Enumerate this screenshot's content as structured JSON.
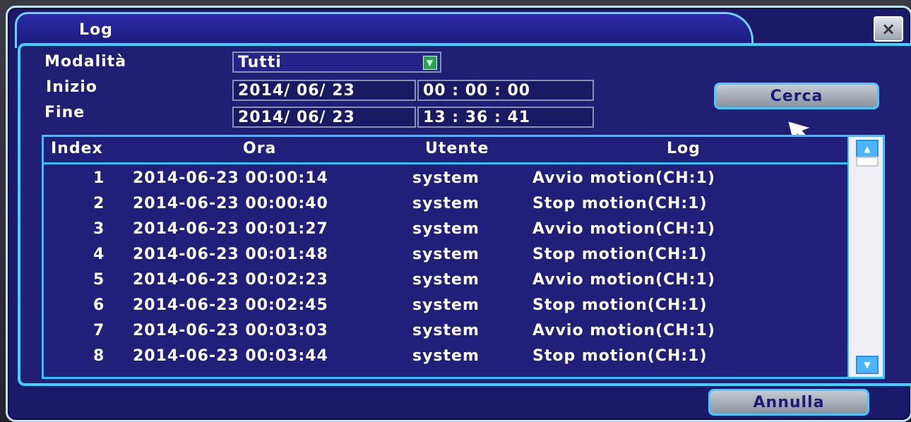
{
  "window": {
    "title": "Log",
    "close_symbol": "×"
  },
  "form": {
    "mode_label": "Modalità",
    "mode_value": "Tutti",
    "start_label": "Inizio",
    "start_date": "2014/ 06/ 23",
    "start_time": "00 : 00 : 00",
    "end_label": "Fine",
    "end_date": "2014/ 06/ 23",
    "end_time": "13 : 36 : 41",
    "search_button": "Cerca"
  },
  "table": {
    "headers": [
      "Index",
      "Ora",
      "Utente",
      "Log"
    ],
    "rows": [
      {
        "index": "1",
        "time": "2014-06-23 00:00:14",
        "user": "system",
        "log": "Avvio motion(CH:1)"
      },
      {
        "index": "2",
        "time": "2014-06-23 00:00:40",
        "user": "system",
        "log": "Stop motion(CH:1)"
      },
      {
        "index": "3",
        "time": "2014-06-23 00:01:27",
        "user": "system",
        "log": "Avvio motion(CH:1)"
      },
      {
        "index": "4",
        "time": "2014-06-23 00:01:48",
        "user": "system",
        "log": "Stop motion(CH:1)"
      },
      {
        "index": "5",
        "time": "2014-06-23 00:02:23",
        "user": "system",
        "log": "Avvio motion(CH:1)"
      },
      {
        "index": "6",
        "time": "2014-06-23 00:02:45",
        "user": "system",
        "log": "Stop motion(CH:1)"
      },
      {
        "index": "7",
        "time": "2014-06-23 00:03:03",
        "user": "system",
        "log": "Avvio motion(CH:1)"
      },
      {
        "index": "8",
        "time": "2014-06-23 00:03:44",
        "user": "system",
        "log": "Stop motion(CH:1)"
      }
    ]
  },
  "footer": {
    "cancel_button": "Annulla"
  },
  "icons": {
    "dropdown": "chevron-down-icon",
    "cursor": "mouse-pointer-icon",
    "scroll_up": "triangle-up-icon",
    "scroll_down": "triangle-down-icon",
    "close": "close-icon"
  },
  "colors": {
    "dialog_bg": "#1b1a6a",
    "accent_border": "#34c1ff",
    "dropdown_arrow": "#2ea04f"
  }
}
